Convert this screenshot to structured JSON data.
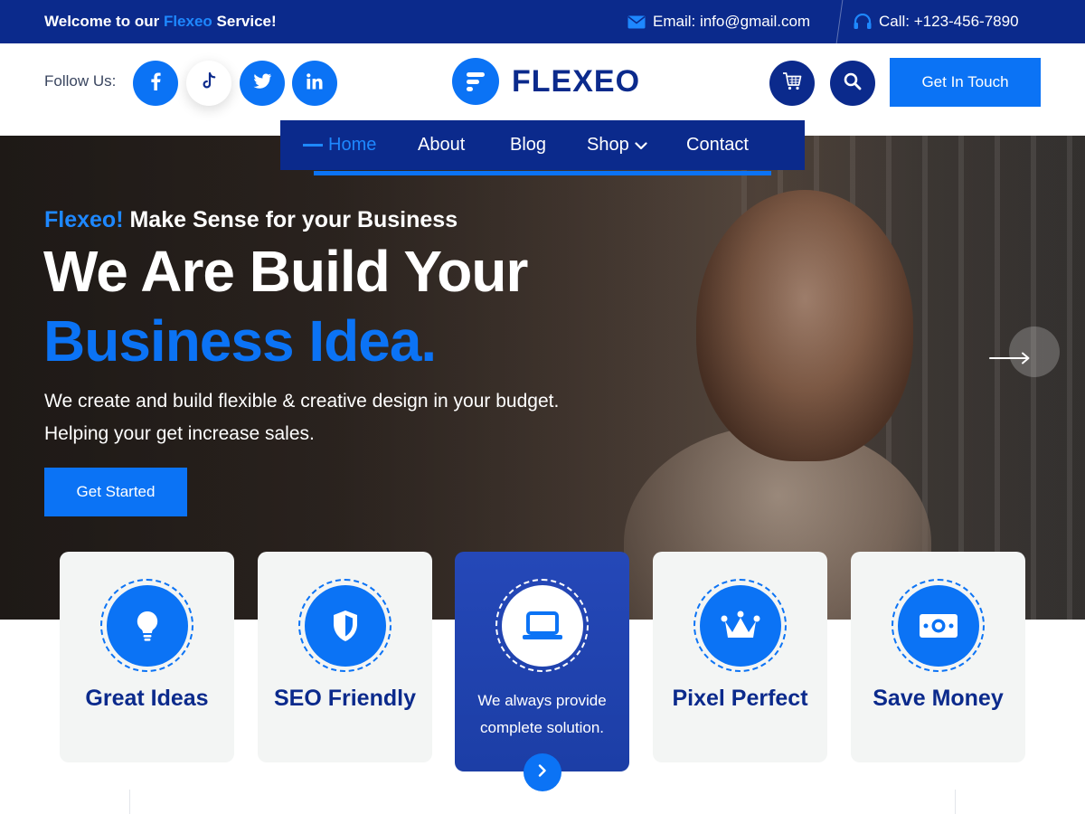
{
  "topbar": {
    "welcome_prefix": "Welcome to our ",
    "welcome_brand": "Flexeo",
    "welcome_suffix": " Service!",
    "email": "Email: info@gmail.com",
    "phone": "Call: +123-456-7890"
  },
  "header": {
    "follow_label": "Follow Us:",
    "social": [
      "facebook-icon",
      "tiktok-icon",
      "twitter-icon",
      "linkedin-icon"
    ],
    "logo_text": "FLEXEO",
    "cta_label": "Get In Touch"
  },
  "nav": {
    "items": [
      {
        "label": "Home",
        "active": true
      },
      {
        "label": "About"
      },
      {
        "label": "Blog"
      },
      {
        "label": "Shop",
        "dropdown": true
      },
      {
        "label": "Contact"
      }
    ]
  },
  "hero": {
    "tagline_brand": "Flexeo!",
    "tagline_rest": " Make Sense for your Business",
    "heading_line1": "We Are Build Your",
    "heading_line2": "Business Idea.",
    "desc_line1": "We create and build flexible & creative design in your budget.",
    "desc_line2": "Helping your get increase sales.",
    "button_label": "Get Started"
  },
  "features": [
    {
      "label": "Great Ideas",
      "icon": "lightbulb-icon"
    },
    {
      "label": "SEO Friendly",
      "icon": "shield-icon"
    },
    {
      "label_line1": "We always provide",
      "label_line2": "complete solution.",
      "icon": "laptop-icon"
    },
    {
      "label": "Pixel Perfect",
      "icon": "crown-icon"
    },
    {
      "label": "Save Money",
      "icon": "money-icon"
    }
  ],
  "colors": {
    "primary": "#0b73f5",
    "navy": "#0b2a8c"
  }
}
